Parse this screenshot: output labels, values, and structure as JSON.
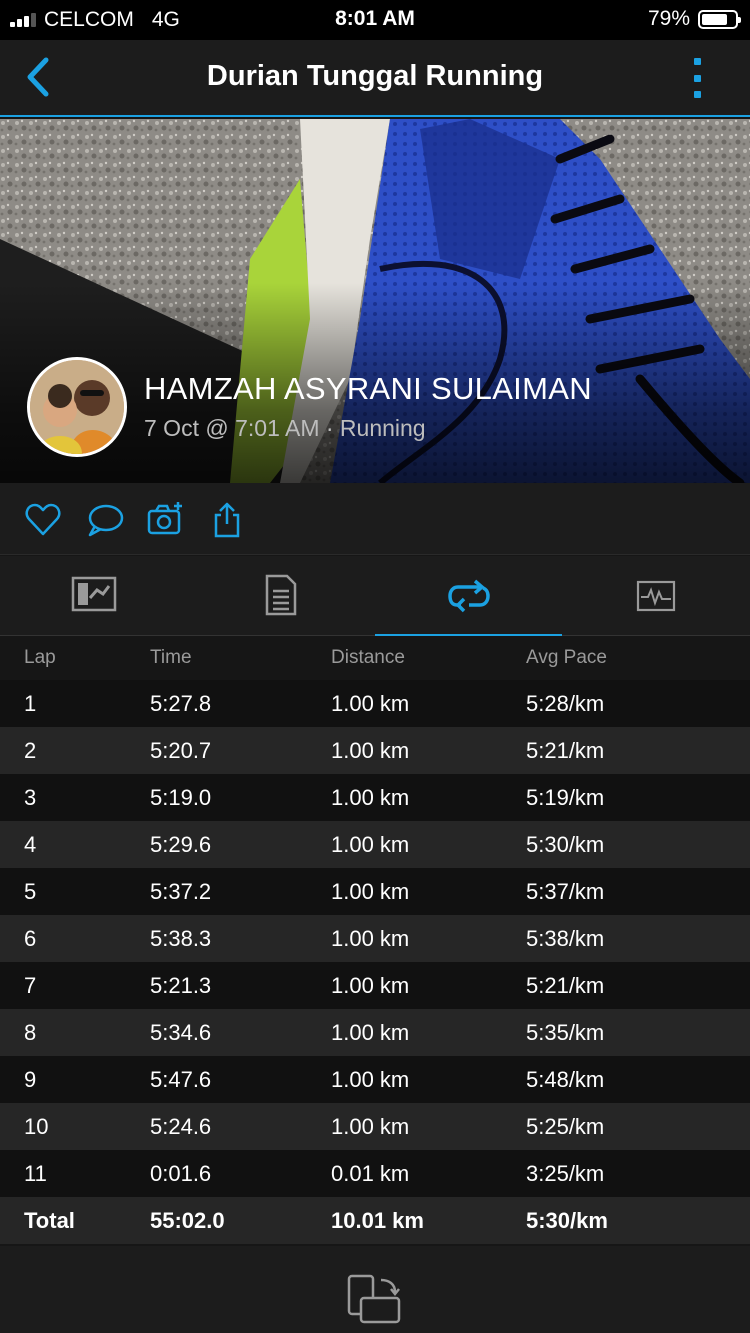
{
  "status_bar": {
    "carrier": "CELCOM",
    "network": "4G",
    "time": "8:01 AM",
    "battery_percent": "79%",
    "battery_level": 0.79
  },
  "nav": {
    "title": "Durian Tunggal Running",
    "back_icon": "chevron-left-icon",
    "menu_icon": "more-vertical-icon"
  },
  "activity": {
    "user_name": "HAMZAH ASYRANI SULAIMAN",
    "meta": "7 Oct @ 7:01 AM · Running"
  },
  "actions": [
    "heart-icon",
    "comment-icon",
    "camera-add-icon",
    "share-icon"
  ],
  "tabs": [
    {
      "id": "overview",
      "icon": "map-summary-icon",
      "active": false
    },
    {
      "id": "stats",
      "icon": "document-list-icon",
      "active": false
    },
    {
      "id": "laps",
      "icon": "laps-loop-icon",
      "active": true
    },
    {
      "id": "charts",
      "icon": "chart-pulse-icon",
      "active": false
    }
  ],
  "laps": {
    "headers": {
      "lap": "Lap",
      "time": "Time",
      "distance": "Distance",
      "pace": "Avg Pace"
    },
    "rows": [
      {
        "lap": "1",
        "time": "5:27.8",
        "distance": "1.00 km",
        "pace": "5:28/km"
      },
      {
        "lap": "2",
        "time": "5:20.7",
        "distance": "1.00 km",
        "pace": "5:21/km"
      },
      {
        "lap": "3",
        "time": "5:19.0",
        "distance": "1.00 km",
        "pace": "5:19/km"
      },
      {
        "lap": "4",
        "time": "5:29.6",
        "distance": "1.00 km",
        "pace": "5:30/km"
      },
      {
        "lap": "5",
        "time": "5:37.2",
        "distance": "1.00 km",
        "pace": "5:37/km"
      },
      {
        "lap": "6",
        "time": "5:38.3",
        "distance": "1.00 km",
        "pace": "5:38/km"
      },
      {
        "lap": "7",
        "time": "5:21.3",
        "distance": "1.00 km",
        "pace": "5:21/km"
      },
      {
        "lap": "8",
        "time": "5:34.6",
        "distance": "1.00 km",
        "pace": "5:35/km"
      },
      {
        "lap": "9",
        "time": "5:47.6",
        "distance": "1.00 km",
        "pace": "5:48/km"
      },
      {
        "lap": "10",
        "time": "5:24.6",
        "distance": "1.00 km",
        "pace": "5:25/km"
      },
      {
        "lap": "11",
        "time": "0:01.6",
        "distance": "0.01 km",
        "pace": "3:25/km"
      }
    ],
    "total": {
      "lap": "Total",
      "time": "55:02.0",
      "distance": "10.01 km",
      "pace": "5:30/km"
    }
  },
  "footer": {
    "icon": "rotate-device-icon"
  }
}
